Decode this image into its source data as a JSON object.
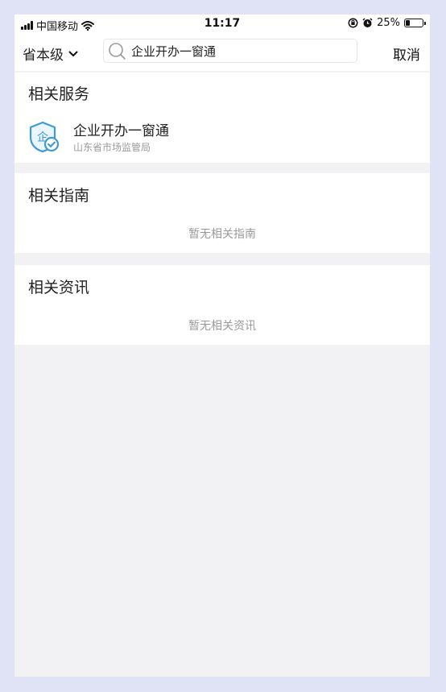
{
  "status_bar": {
    "carrier": "中国移动",
    "time": "11:17",
    "battery_percent": "25%",
    "battery_level": 0.25
  },
  "header": {
    "region_label": "省本级",
    "search_value": "企业开办一窗通",
    "cancel_label": "取消"
  },
  "services": {
    "title": "相关服务",
    "items": [
      {
        "icon": "enterprise-shield-icon",
        "icon_char": "企",
        "name": "企业开办一窗通",
        "department": "山东省市场监管局"
      }
    ]
  },
  "guides": {
    "title": "相关指南",
    "empty_text": "暂无相关指南"
  },
  "news": {
    "title": "相关资讯",
    "empty_text": "暂无相关资讯"
  },
  "colors": {
    "background": "#f2f2f4",
    "icon_accent": "#3d9ad6",
    "muted_text": "#9a9a9a"
  }
}
